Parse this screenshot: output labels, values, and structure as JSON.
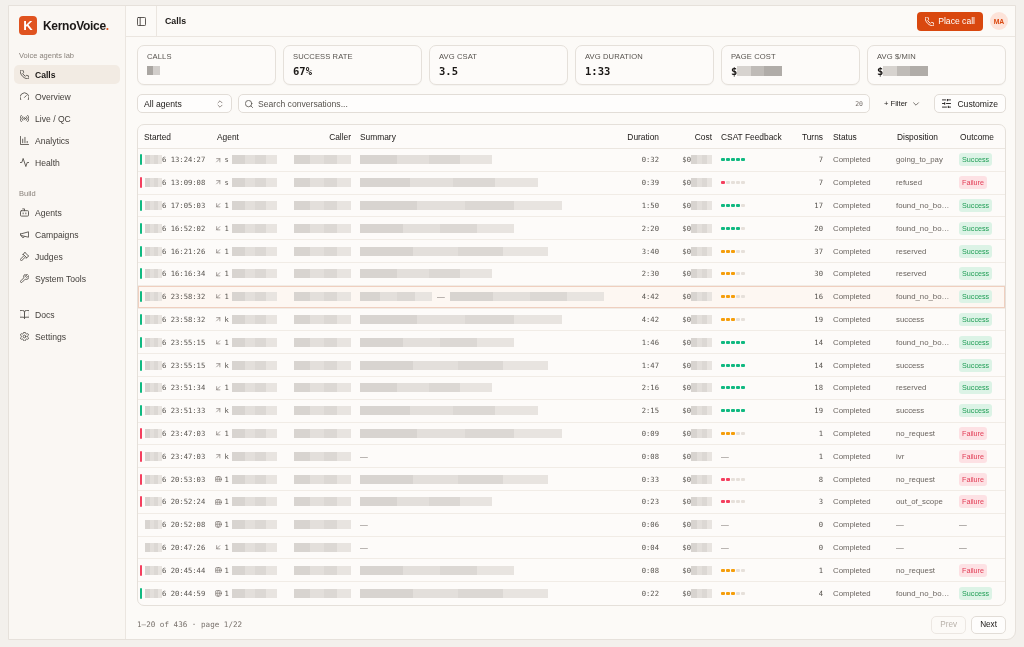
{
  "sidebar": {
    "brand": {
      "logo": "K",
      "name": "KernoVoice",
      "suffix": "."
    },
    "sections": [
      {
        "title": "Voice agents lab",
        "items": [
          {
            "label": "Calls",
            "selected": true
          },
          {
            "label": "Overview",
            "selected": false
          },
          {
            "label": "Live / QC",
            "selected": false
          },
          {
            "label": "Analytics",
            "selected": false
          },
          {
            "label": "Health",
            "selected": false
          }
        ]
      },
      {
        "title": "Build",
        "items": [
          {
            "label": "Agents",
            "selected": false
          },
          {
            "label": "Campaigns",
            "selected": false
          },
          {
            "label": "Judges",
            "selected": false
          },
          {
            "label": "System Tools",
            "selected": false
          }
        ]
      },
      {
        "items": [
          {
            "label": "Docs",
            "selected": false
          },
          {
            "label": "Settings",
            "selected": false
          }
        ]
      }
    ]
  },
  "header": {
    "title": "Calls",
    "action": "Place call",
    "avatar": "MA"
  },
  "stats": [
    {
      "label": "CALLS",
      "redacted": true
    },
    {
      "label": "SUCCESS RATE",
      "value": "67%"
    },
    {
      "label": "AVG CSAT",
      "value": "3.5"
    },
    {
      "label": "AVG DURATION",
      "value": "1:33"
    },
    {
      "label": "PAGE COST",
      "value": "$",
      "redacted": true
    },
    {
      "label": "AVG $/MIN",
      "value": "$",
      "redacted": true
    }
  ],
  "toolbar": {
    "agent_select": "All agents",
    "search": {
      "placeholder": "Search conversations...",
      "count": "20"
    },
    "filter": "+ Filter",
    "customize": "Customize"
  },
  "table": {
    "columns": [
      {
        "label": "Started"
      },
      {
        "label": "Agent"
      },
      {
        "label": "Caller"
      },
      {
        "label": "Summary"
      },
      {
        "label": "Duration"
      },
      {
        "label": "Cost"
      },
      {
        "label": "CSAT Feedback"
      },
      {
        "label": "Turns"
      },
      {
        "label": "Status"
      },
      {
        "label": "Disposition"
      },
      {
        "label": "Outcome"
      }
    ],
    "rows": [
      {
        "started": "6 13:24:27",
        "color": "#10b981",
        "selected": false,
        "agent": {
          "kind": "outbound",
          "name": "s"
        },
        "summary": {
          "kind": "redacted"
        },
        "duration": "0:32",
        "cost": "$0",
        "csat": {
          "stars": 5
        },
        "turns": "7",
        "status": "Completed",
        "disposition": "going_to_pay",
        "outcome": {
          "kind": "success",
          "text": "Success"
        }
      },
      {
        "started": "6 13:09:08",
        "color": "#f43f5e",
        "selected": false,
        "agent": {
          "kind": "outbound",
          "name": "s"
        },
        "summary": {
          "kind": "redacted"
        },
        "duration": "0:39",
        "cost": "$0",
        "csat": {
          "stars": 1
        },
        "turns": "7",
        "status": "Completed",
        "disposition": "refused",
        "outcome": {
          "kind": "failure",
          "text": "Failure"
        }
      },
      {
        "started": "6 17:05:03",
        "color": "#10b981",
        "selected": false,
        "agent": {
          "kind": "inbound",
          "name": "1"
        },
        "summary": {
          "kind": "redacted"
        },
        "duration": "1:50",
        "cost": "$0",
        "csat": {
          "stars": 4
        },
        "turns": "17",
        "status": "Completed",
        "disposition": "found_no_bo…",
        "outcome": {
          "kind": "success",
          "text": "Success"
        }
      },
      {
        "started": "6 16:52:02",
        "color": "#10b981",
        "selected": false,
        "agent": {
          "kind": "inbound",
          "name": "1"
        },
        "summary": {
          "kind": "redacted"
        },
        "duration": "2:20",
        "cost": "$0",
        "csat": {
          "stars": 4
        },
        "turns": "20",
        "status": "Completed",
        "disposition": "found_no_bo…",
        "outcome": {
          "kind": "success",
          "text": "Success"
        }
      },
      {
        "started": "6 16:21:26",
        "color": "#10b981",
        "selected": false,
        "agent": {
          "kind": "inbound",
          "name": "1"
        },
        "summary": {
          "kind": "redacted"
        },
        "duration": "3:40",
        "cost": "$0",
        "csat": {
          "stars": 3
        },
        "turns": "37",
        "status": "Completed",
        "disposition": "reserved",
        "outcome": {
          "kind": "success",
          "text": "Success"
        }
      },
      {
        "started": "6 16:16:34",
        "color": "#10b981",
        "selected": false,
        "agent": {
          "kind": "inbound",
          "name": "1"
        },
        "summary": {
          "kind": "redacted"
        },
        "duration": "2:30",
        "cost": "$0",
        "csat": {
          "stars": 3
        },
        "turns": "30",
        "status": "Completed",
        "disposition": "reserved",
        "outcome": {
          "kind": "success",
          "text": "Success"
        }
      },
      {
        "started": "6 23:58:32",
        "color": "#10b981",
        "selected": true,
        "agent": {
          "kind": "inbound",
          "name": "1"
        },
        "summary": {
          "kind": "split",
          "text": "—"
        },
        "duration": "4:42",
        "cost": "$0",
        "csat": {
          "stars": 3
        },
        "turns": "16",
        "status": "Completed",
        "disposition": "found_no_bo…",
        "outcome": {
          "kind": "success",
          "text": "Success"
        }
      },
      {
        "started": "6 23:58:32",
        "color": "#10b981",
        "selected": false,
        "agent": {
          "kind": "outbound",
          "name": "k"
        },
        "summary": {
          "kind": "redacted"
        },
        "duration": "4:42",
        "cost": "$0",
        "csat": {
          "stars": 3
        },
        "turns": "19",
        "status": "Completed",
        "disposition": "success",
        "outcome": {
          "kind": "success",
          "text": "Success"
        }
      },
      {
        "started": "6 23:55:15",
        "color": "#10b981",
        "selected": false,
        "agent": {
          "kind": "inbound",
          "name": "1"
        },
        "summary": {
          "kind": "redacted"
        },
        "duration": "1:46",
        "cost": "$0",
        "csat": {
          "stars": 5
        },
        "turns": "14",
        "status": "Completed",
        "disposition": "found_no_bo…",
        "outcome": {
          "kind": "success",
          "text": "Success"
        }
      },
      {
        "started": "6 23:55:15",
        "color": "#10b981",
        "selected": false,
        "agent": {
          "kind": "outbound",
          "name": "k"
        },
        "summary": {
          "kind": "redacted"
        },
        "duration": "1:47",
        "cost": "$0",
        "csat": {
          "stars": 5
        },
        "turns": "14",
        "status": "Completed",
        "disposition": "success",
        "outcome": {
          "kind": "success",
          "text": "Success"
        }
      },
      {
        "started": "6 23:51:34",
        "color": "#10b981",
        "selected": false,
        "agent": {
          "kind": "inbound",
          "name": "1"
        },
        "summary": {
          "kind": "redacted"
        },
        "duration": "2:16",
        "cost": "$0",
        "csat": {
          "stars": 5
        },
        "turns": "18",
        "status": "Completed",
        "disposition": "reserved",
        "outcome": {
          "kind": "success",
          "text": "Success"
        }
      },
      {
        "started": "6 23:51:33",
        "color": "#10b981",
        "selected": false,
        "agent": {
          "kind": "outbound",
          "name": "k"
        },
        "summary": {
          "kind": "redacted"
        },
        "duration": "2:15",
        "cost": "$0",
        "csat": {
          "stars": 5
        },
        "turns": "19",
        "status": "Completed",
        "disposition": "success",
        "outcome": {
          "kind": "success",
          "text": "Success"
        }
      },
      {
        "started": "6 23:47:03",
        "color": "#f43f5e",
        "selected": false,
        "agent": {
          "kind": "inbound",
          "name": "1"
        },
        "summary": {
          "kind": "redacted"
        },
        "duration": "0:09",
        "cost": "$0",
        "csat": {
          "stars": 3
        },
        "turns": "1",
        "status": "Completed",
        "disposition": "no_request",
        "outcome": {
          "kind": "failure",
          "text": "Failure"
        }
      },
      {
        "started": "6 23:47:03",
        "color": "#f43f5e",
        "selected": false,
        "agent": {
          "kind": "outbound",
          "name": "k"
        },
        "summary": {
          "kind": "empty",
          "text": "—"
        },
        "duration": "0:08",
        "cost": "$0",
        "csat": {
          "text": "—"
        },
        "turns": "1",
        "status": "Completed",
        "disposition": "ivr",
        "outcome": {
          "kind": "failure",
          "text": "Failure"
        }
      },
      {
        "started": "6 20:53:03",
        "color": "#f43f5e",
        "selected": false,
        "agent": {
          "kind": "web",
          "name": "1"
        },
        "summary": {
          "kind": "redacted"
        },
        "duration": "0:33",
        "cost": "$0",
        "csat": {
          "stars": 2
        },
        "turns": "8",
        "status": "Completed",
        "disposition": "no_request",
        "outcome": {
          "kind": "failure",
          "text": "Failure"
        }
      },
      {
        "started": "6 20:52:24",
        "color": "#f43f5e",
        "selected": false,
        "agent": {
          "kind": "web",
          "name": "1"
        },
        "summary": {
          "kind": "redacted"
        },
        "duration": "0:23",
        "cost": "$0",
        "csat": {
          "stars": 2
        },
        "turns": "3",
        "status": "Completed",
        "disposition": "out_of_scope",
        "outcome": {
          "kind": "failure",
          "text": "Failure"
        }
      },
      {
        "started": "6 20:52:08",
        "selected": false,
        "agent": {
          "kind": "web",
          "name": "1"
        },
        "summary": {
          "kind": "empty",
          "text": "—"
        },
        "duration": "0:06",
        "cost": "$0",
        "csat": {
          "text": "—"
        },
        "turns": "0",
        "status": "Completed",
        "disposition": "—",
        "outcome": {
          "kind": "none",
          "text": "—"
        }
      },
      {
        "started": "6 20:47:26",
        "selected": false,
        "agent": {
          "kind": "inbound",
          "name": "1"
        },
        "summary": {
          "kind": "empty",
          "text": "—"
        },
        "duration": "0:04",
        "cost": "$0",
        "csat": {
          "text": "—"
        },
        "turns": "0",
        "status": "Completed",
        "disposition": "—",
        "outcome": {
          "kind": "none",
          "text": "—"
        }
      },
      {
        "started": "6 20:45:44",
        "color": "#f43f5e",
        "selected": false,
        "agent": {
          "kind": "web",
          "name": "1"
        },
        "summary": {
          "kind": "redacted"
        },
        "duration": "0:08",
        "cost": "$0",
        "csat": {
          "stars": 3
        },
        "turns": "1",
        "status": "Completed",
        "disposition": "no_request",
        "outcome": {
          "kind": "failure",
          "text": "Failure"
        }
      },
      {
        "started": "6 20:44:59",
        "color": "#10b981",
        "selected": false,
        "agent": {
          "kind": "web",
          "name": "1"
        },
        "summary": {
          "kind": "redacted"
        },
        "duration": "0:22",
        "cost": "$0",
        "csat": {
          "stars": 3
        },
        "turns": "4",
        "status": "Completed",
        "disposition": "found_no_bo…",
        "outcome": {
          "kind": "success",
          "text": "Success"
        }
      }
    ]
  },
  "pagination": {
    "summary": "1–20 of 436 · page 1/22",
    "buttons": [
      {
        "label": "Prev",
        "disabled": true
      },
      {
        "label": "Next",
        "disabled": false
      }
    ]
  }
}
